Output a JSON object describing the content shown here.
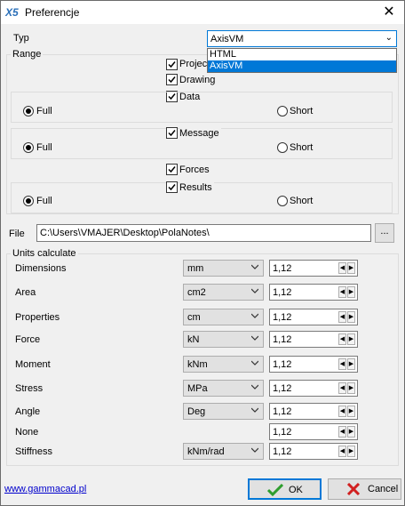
{
  "window": {
    "title": "Preferencje",
    "app_icon": "axis-x5-icon",
    "close_glyph": "✕"
  },
  "typ": {
    "label": "Typ",
    "selected": "AxisVM",
    "options": [
      "HTML",
      "AxisVM"
    ]
  },
  "range": {
    "label": "Range",
    "items": {
      "project": "Projec",
      "drawing": "Drawing",
      "data": "Data",
      "message": "Message",
      "forces": "Forces",
      "results": "Results"
    },
    "radio_full": "Full",
    "radio_short": "Short"
  },
  "file": {
    "label": "File",
    "value": "C:\\Users\\VMAJER\\Desktop\\PolaNotes\\",
    "browse": "..."
  },
  "units": {
    "label": "Units calculate",
    "rows": [
      {
        "name": "Dimensions",
        "unit": "mm",
        "value": "1,12"
      },
      {
        "name": "Area",
        "unit": "cm2",
        "value": "1,12"
      },
      {
        "name": "Properties",
        "unit": "cm",
        "value": "1,12"
      },
      {
        "name": "Force",
        "unit": "kN",
        "value": "1,12"
      },
      {
        "name": "Moment",
        "unit": "kNm",
        "value": "1,12"
      },
      {
        "name": "Stress",
        "unit": "MPa",
        "value": "1,12"
      },
      {
        "name": "Angle",
        "unit": "Deg",
        "value": "1,12"
      },
      {
        "name": "None",
        "unit": "",
        "value": "1,12"
      },
      {
        "name": "Stiffness",
        "unit": "kNm/rad",
        "value": "1,12"
      }
    ]
  },
  "footer": {
    "link": "www.gammacad.pl",
    "ok": "OK",
    "cancel": "Cancel"
  },
  "colors": {
    "accent": "#0078d7",
    "ok_check": "#2e9e2e",
    "cancel_x": "#d12020",
    "link": "#0000cc"
  }
}
